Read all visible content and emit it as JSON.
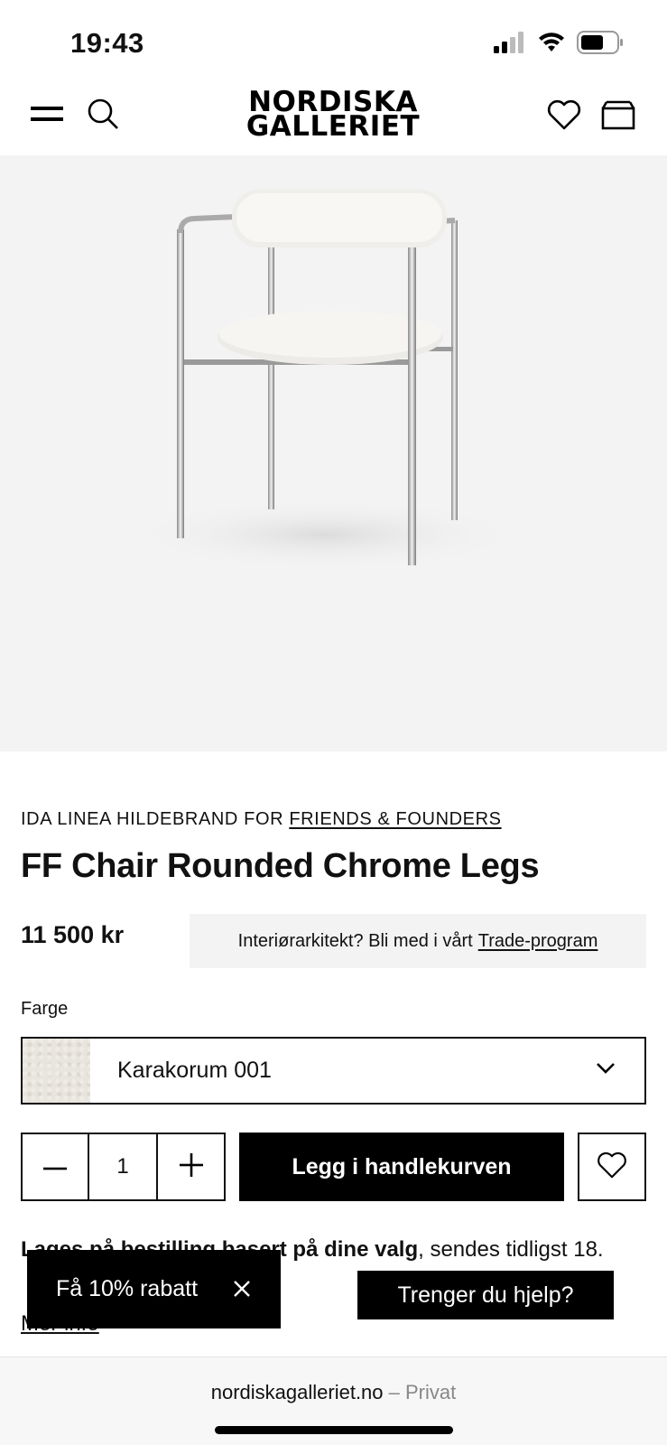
{
  "status_bar": {
    "time": "19:43",
    "icons": [
      "signal-icon",
      "wifi-icon",
      "battery-icon"
    ]
  },
  "header": {
    "logo_line1": "NORDISKA",
    "logo_line2": "GALLERIET",
    "icons": [
      "menu-icon",
      "search-icon",
      "heart-icon",
      "cart-icon"
    ]
  },
  "product": {
    "designer": "IDA LINEA HILDEBRAND FOR",
    "brand": "FRIENDS & FOUNDERS",
    "title": "FF Chair Rounded Chrome Legs",
    "price": "11 500 kr",
    "trade_text": "Interiørarkitekt? Bli med i vårt",
    "trade_link": "Trade-program",
    "color_label": "Farge",
    "color_value": "Karakorum 001",
    "quantity": "1",
    "add_to_cart": "Legg i handlekurven",
    "delivery_bold": "Lages på bestilling basert på dine valg",
    "delivery_rest": ", sendes tidligst 18.",
    "more_info": "Mer info"
  },
  "popups": {
    "discount": "Få 10% rabatt",
    "help": "Trenger du hjelp?"
  },
  "browser": {
    "domain": "nordiskagalleriet.no",
    "separator": " – ",
    "mode": "Privat"
  },
  "colors": {
    "accent": "#000000",
    "image_bg": "#f3f3f3",
    "trade_bg": "#f3f3f3"
  }
}
